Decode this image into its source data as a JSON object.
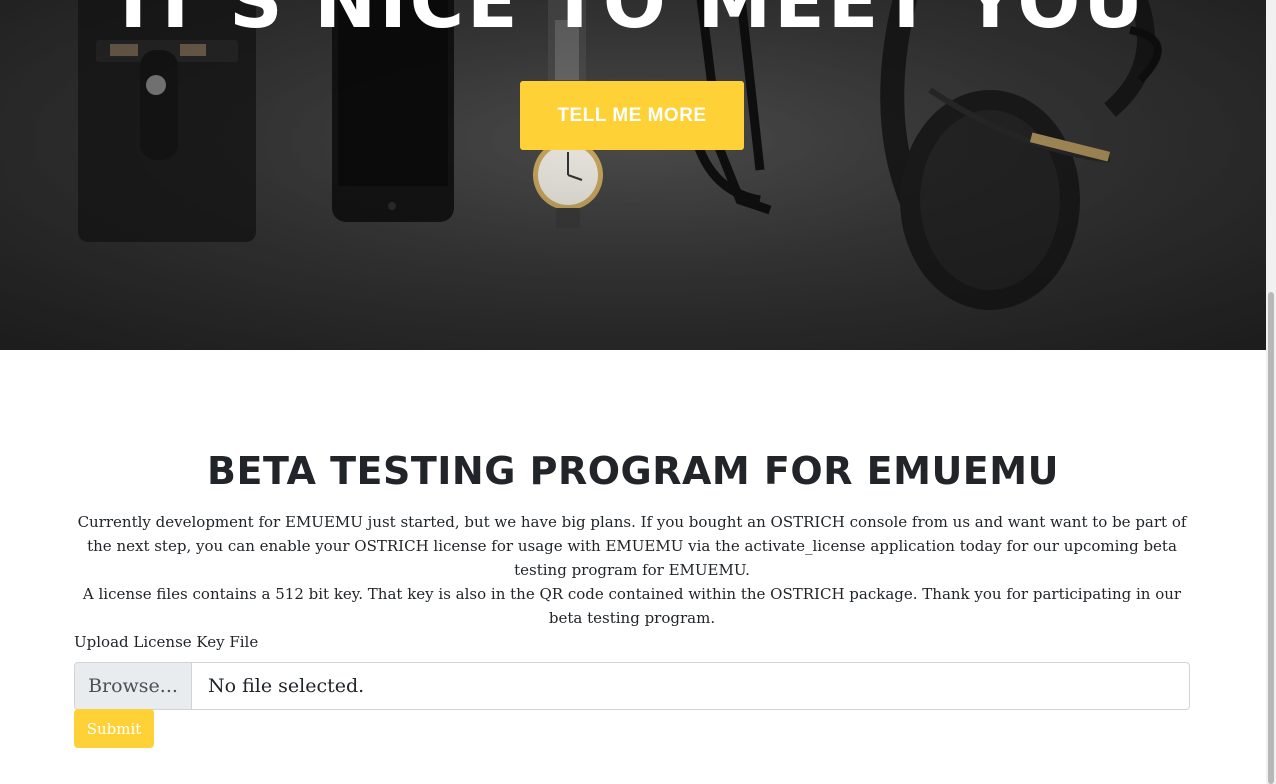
{
  "hero": {
    "heading": "IT'S NICE TO MEET YOU",
    "cta_label": "TELL ME MORE"
  },
  "beta": {
    "title": "BETA TESTING PROGRAM FOR EMUEMU",
    "paragraph_1": "Currently development for EMUEMU just started, but we have big plans. If you bought an OSTRICH console from us and want want to be part of the next step, you can enable your OSTRICH license for usage with EMUEMU via the activate_license application today for our upcoming beta testing program for EMUEMU.",
    "paragraph_2": "A license files contains a 512 bit key. That key is also in the QR code contained within the OSTRICH package. Thank you for participating in our beta testing program.",
    "upload_label": "Upload License Key File",
    "browse_label": "Browse...",
    "file_status": "No file selected.",
    "submit_label": "Submit"
  },
  "colors": {
    "accent": "#fed136",
    "text": "#212529",
    "hero_bg": "#3a3a3a"
  }
}
